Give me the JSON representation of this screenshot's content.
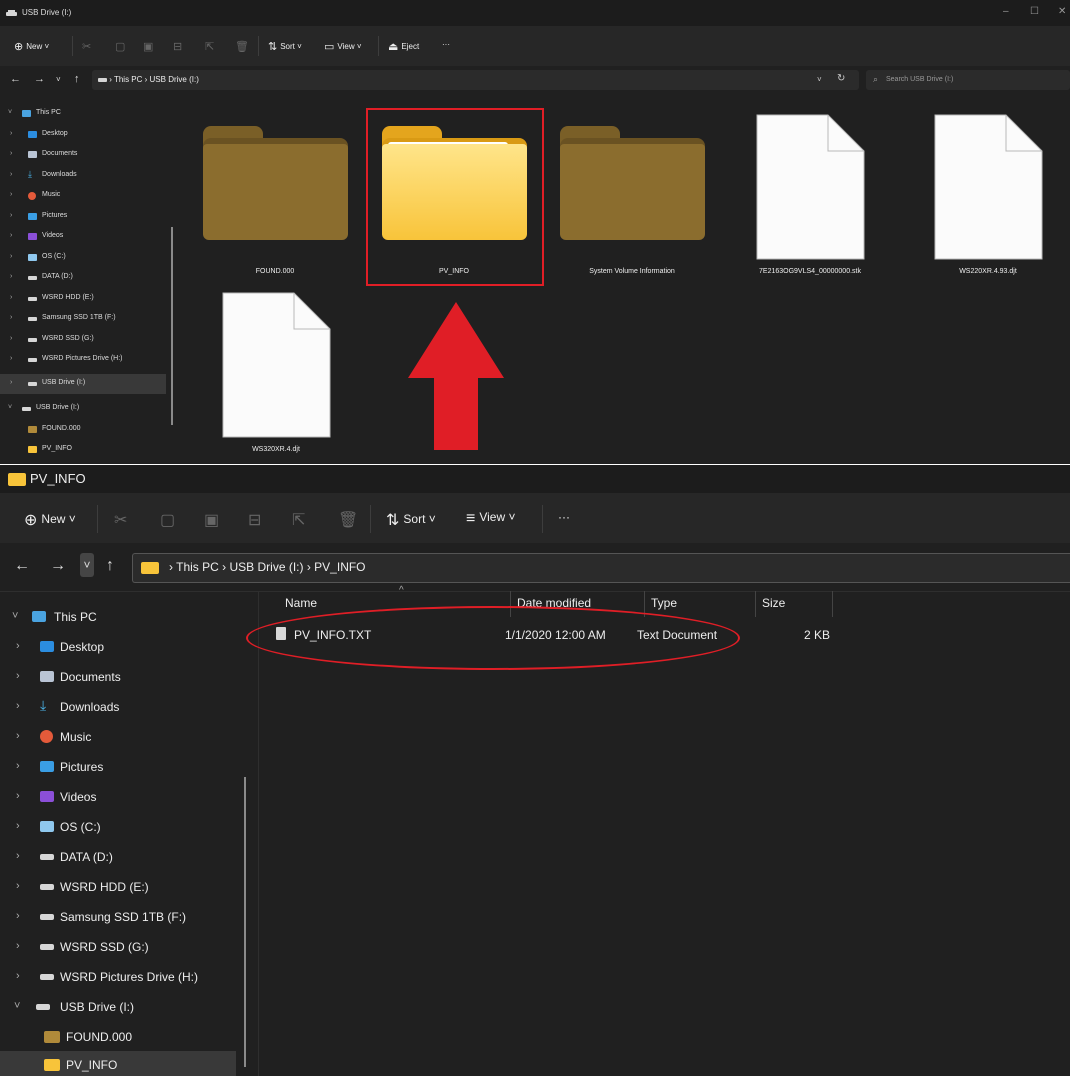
{
  "window1": {
    "title": "USB Drive (I:)",
    "toolbar": {
      "new": "New",
      "sort": "Sort",
      "view": "View",
      "eject": "Eject",
      "more": "···"
    },
    "breadcrumb": [
      "This PC",
      "USB Drive (I:)"
    ],
    "search_placeholder": "Search USB Drive (I:)",
    "sidebar": [
      {
        "label": "This PC",
        "icon": "pc-icon"
      },
      {
        "label": "Desktop",
        "icon": "desktop-icon"
      },
      {
        "label": "Documents",
        "icon": "documents-icon"
      },
      {
        "label": "Downloads",
        "icon": "downloads-icon"
      },
      {
        "label": "Music",
        "icon": "music-icon"
      },
      {
        "label": "Pictures",
        "icon": "pictures-icon"
      },
      {
        "label": "Videos",
        "icon": "videos-icon"
      },
      {
        "label": "OS (C:)",
        "icon": "os-drive-icon"
      },
      {
        "label": "DATA (D:)",
        "icon": "drive-icon"
      },
      {
        "label": "WSRD HDD (E:)",
        "icon": "drive-icon"
      },
      {
        "label": "Samsung SSD 1TB (F:)",
        "icon": "drive-icon"
      },
      {
        "label": "WSRD SSD (G:)",
        "icon": "drive-icon"
      },
      {
        "label": "WSRD Pictures Drive (H:)",
        "icon": "drive-icon"
      },
      {
        "label": "USB Drive (I:)",
        "icon": "drive-icon"
      },
      {
        "label": "USB Drive (I:)",
        "icon": "drive-icon"
      },
      {
        "label": "FOUND.000",
        "icon": "folder-icon"
      },
      {
        "label": "PV_INFO",
        "icon": "folder-icon"
      }
    ],
    "items": [
      {
        "name": "FOUND.000",
        "type": "folder"
      },
      {
        "name": "PV_INFO",
        "type": "folder"
      },
      {
        "name": "System Volume Information",
        "type": "folder"
      },
      {
        "name": "7E2163OG9VLS4_00000000.stk",
        "type": "file"
      },
      {
        "name": "WS220XR.4.93.djt",
        "type": "file"
      },
      {
        "name": "WS320XR.4.djt",
        "type": "file"
      }
    ]
  },
  "window2": {
    "title": "PV_INFO",
    "toolbar": {
      "new": "New",
      "sort": "Sort",
      "view": "View",
      "more": "···"
    },
    "breadcrumb": [
      "This PC",
      "USB Drive (I:)",
      "PV_INFO"
    ],
    "columns": {
      "name": "Name",
      "date": "Date modified",
      "type": "Type",
      "size": "Size"
    },
    "files": [
      {
        "name": "PV_INFO.TXT",
        "date": "1/1/2020 12:00 AM",
        "type": "Text Document",
        "size": "2 KB"
      }
    ],
    "sidebar": [
      {
        "label": "This PC"
      },
      {
        "label": "Desktop"
      },
      {
        "label": "Documents"
      },
      {
        "label": "Downloads"
      },
      {
        "label": "Music"
      },
      {
        "label": "Pictures"
      },
      {
        "label": "Videos"
      },
      {
        "label": "OS (C:)"
      },
      {
        "label": "DATA (D:)"
      },
      {
        "label": "WSRD HDD (E:)"
      },
      {
        "label": "Samsung SSD 1TB (F:)"
      },
      {
        "label": "WSRD SSD (G:)"
      },
      {
        "label": "WSRD Pictures Drive (H:)"
      },
      {
        "label": "USB Drive (I:)"
      },
      {
        "label": "FOUND.000"
      },
      {
        "label": "PV_INFO"
      }
    ]
  },
  "colors": {
    "annotation_red": "#e01e26",
    "folder_yellow": "#f8c43a",
    "folder_dim": "#8b6d2e",
    "window_bg": "#202020"
  }
}
